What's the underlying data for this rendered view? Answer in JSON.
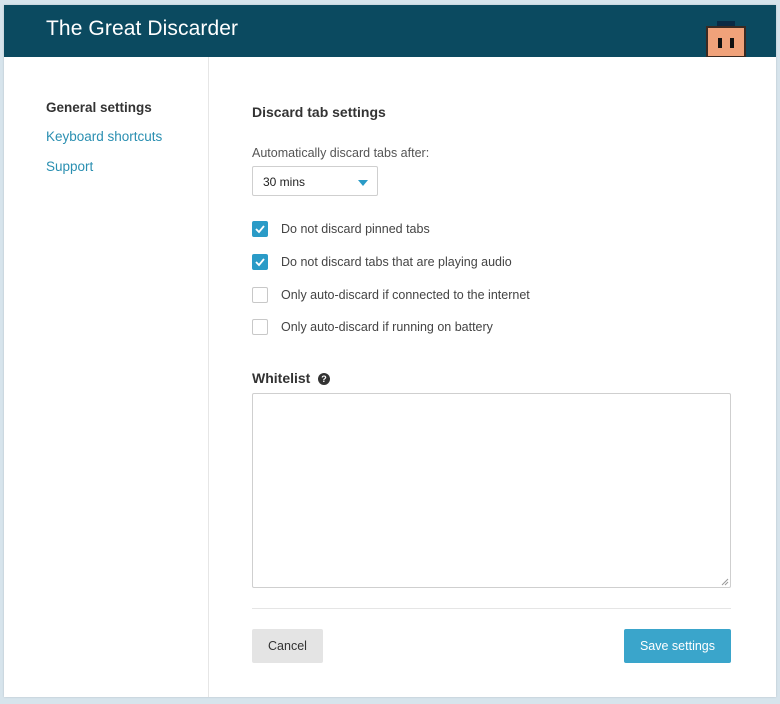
{
  "header": {
    "title": "The Great Discarder",
    "logo_icon": "discarder-logo-icon"
  },
  "sidebar": {
    "items": [
      {
        "label": "General settings",
        "active": true
      },
      {
        "label": "Keyboard shortcuts",
        "active": false
      },
      {
        "label": "Support",
        "active": false
      }
    ]
  },
  "settings": {
    "section_title": "Discard tab settings",
    "discard_after_label": "Automatically discard tabs after:",
    "discard_after_value": "30 mins",
    "options": [
      {
        "label": "Do not discard pinned tabs",
        "checked": true
      },
      {
        "label": "Do not discard tabs that are playing audio",
        "checked": true
      },
      {
        "label": "Only auto-discard if connected to the internet",
        "checked": false
      },
      {
        "label": "Only auto-discard if running on battery",
        "checked": false
      }
    ]
  },
  "whitelist": {
    "title": "Whitelist",
    "help_icon_glyph": "?",
    "value": ""
  },
  "actions": {
    "cancel_label": "Cancel",
    "save_label": "Save settings"
  },
  "colors": {
    "header_bg": "#0b4a60",
    "accent": "#2a9bc7",
    "link": "#2a8fb1",
    "save_button": "#3aa5cb"
  }
}
